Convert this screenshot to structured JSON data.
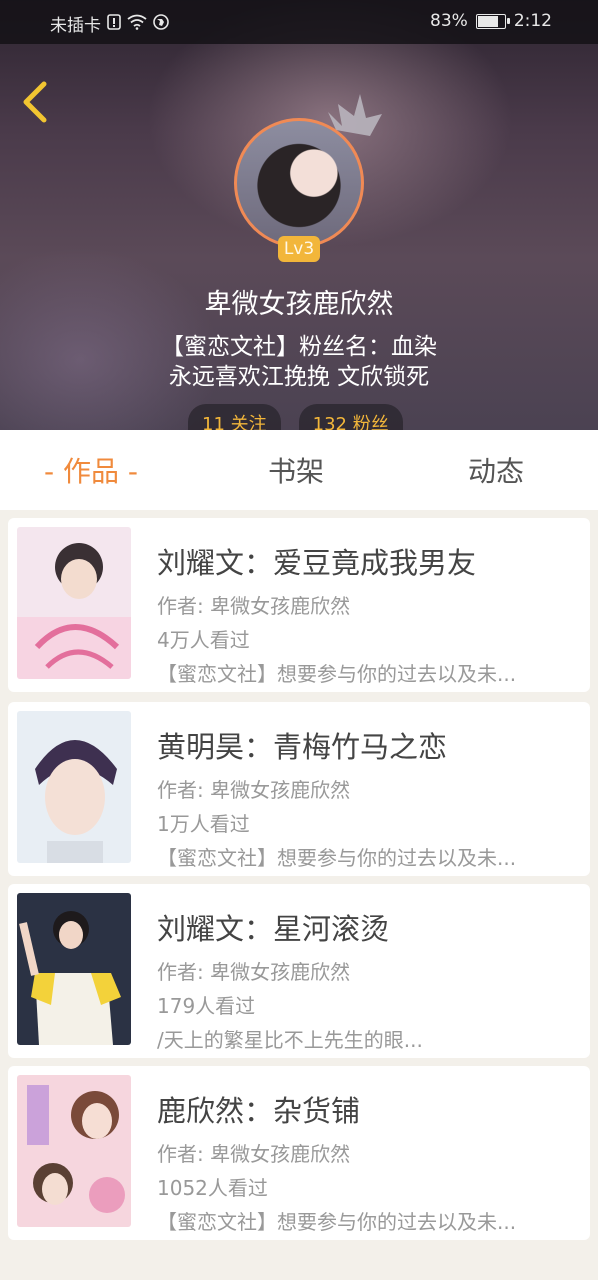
{
  "status_bar": {
    "carrier": "未插卡",
    "battery_percent": "83%",
    "battery_level": 0.83,
    "time": "2:12"
  },
  "profile": {
    "level": "Lv3",
    "username": "卑微女孩鹿欣然",
    "bio_line1": "【蜜恋文社】粉丝名：血染",
    "bio_line2": "永远喜欢江挽挽 文欣锁死",
    "following": "11 关注",
    "followers": "132 粉丝"
  },
  "tabs": [
    {
      "label": "- 作品 -",
      "active": true
    },
    {
      "label": "书架",
      "active": false
    },
    {
      "label": "动态",
      "active": false
    }
  ],
  "books": [
    {
      "title": "刘耀文：爱豆竟成我男友",
      "author": "作者: 卑微女孩鹿欣然",
      "views": "4万人看过",
      "desc": "【蜜恋文社】想要参与你的过去以及未..."
    },
    {
      "title": "黄明昊：青梅竹马之恋",
      "author": "作者: 卑微女孩鹿欣然",
      "views": "1万人看过",
      "desc": "【蜜恋文社】想要参与你的过去以及未..."
    },
    {
      "title": "刘耀文：星河滚烫",
      "author": "作者: 卑微女孩鹿欣然",
      "views": "179人看过",
      "desc": "/天上的繁星比不上先生的眼..."
    },
    {
      "title": "鹿欣然：杂货铺",
      "author": "作者: 卑微女孩鹿欣然",
      "views": "1052人看过",
      "desc": "【蜜恋文社】想要参与你的过去以及未..."
    }
  ],
  "colors": {
    "accent": "#f08a3c",
    "level_badge": "#f2b63a",
    "back_arrow": "#f2c531"
  }
}
